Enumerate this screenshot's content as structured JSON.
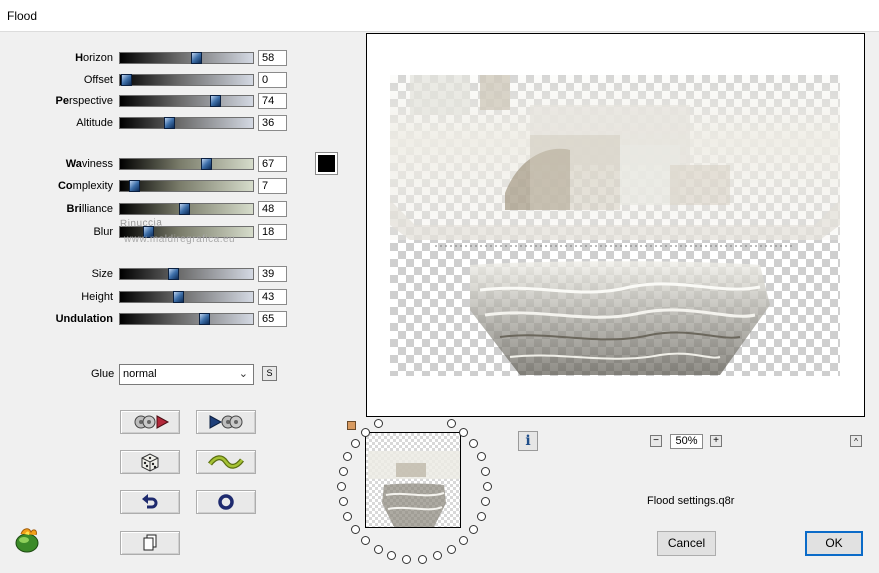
{
  "window": {
    "title": "Flood"
  },
  "params": [
    {
      "key": "horizon",
      "label_bold": "H",
      "label_rest": "orizon",
      "value": "58",
      "fraction": 0.58,
      "track": "grey"
    },
    {
      "key": "offset",
      "label_bold": "",
      "label_rest": "Offset",
      "value": "0",
      "fraction": 0.0,
      "track": "grey"
    },
    {
      "key": "perspective",
      "label_bold": "Pe",
      "label_rest": "rspective",
      "value": "74",
      "fraction": 0.74,
      "track": "grey"
    },
    {
      "key": "altitude",
      "label_bold": "",
      "label_rest": "Altitude",
      "value": "36",
      "fraction": 0.36,
      "track": "grey"
    },
    {
      "key": "waviness",
      "label_bold": "Wa",
      "label_rest": "viness",
      "value": "67",
      "fraction": 0.67,
      "track": "green"
    },
    {
      "key": "complexity",
      "label_bold": "Co",
      "label_rest": "mplexity",
      "value": "7",
      "fraction": 0.07,
      "track": "green"
    },
    {
      "key": "brilliance",
      "label_bold": "Bri",
      "label_rest": "lliance",
      "value": "48",
      "fraction": 0.48,
      "track": "green"
    },
    {
      "key": "blur",
      "label_bold": "",
      "label_rest": "Blur",
      "value": "18",
      "fraction": 0.18,
      "track": "green"
    },
    {
      "key": "size",
      "label_bold": "",
      "label_rest": "Size",
      "value": "39",
      "fraction": 0.39,
      "track": "grey"
    },
    {
      "key": "height",
      "label_bold": "",
      "label_rest": "Height",
      "value": "43",
      "fraction": 0.43,
      "track": "grey"
    },
    {
      "key": "undulation",
      "label_bold": "Undulation",
      "label_rest": "",
      "value": "65",
      "fraction": 0.65,
      "track": "grey"
    }
  ],
  "colors": {
    "flood_color": "#000000",
    "ok_border": "#0b6bc8"
  },
  "watermark": {
    "line1": "Rinuccia",
    "line2": "www.maldiregrafica.eu"
  },
  "glue": {
    "label": "Glue",
    "value": "normal",
    "s_button": "S"
  },
  "tools": {
    "random_left": "random-left-icon",
    "random_right": "random-right-icon",
    "dice": "dice-icon",
    "wave": "wave-icon",
    "undo": "undo-icon",
    "reset": "reset-icon",
    "copy": "copy-icon"
  },
  "zoom": {
    "minus": "−",
    "value": "50%",
    "plus": "+"
  },
  "info_label": "i",
  "caret_label": "^",
  "settings_file": "Flood settings.q8r",
  "buttons": {
    "cancel": "Cancel",
    "ok": "OK"
  }
}
